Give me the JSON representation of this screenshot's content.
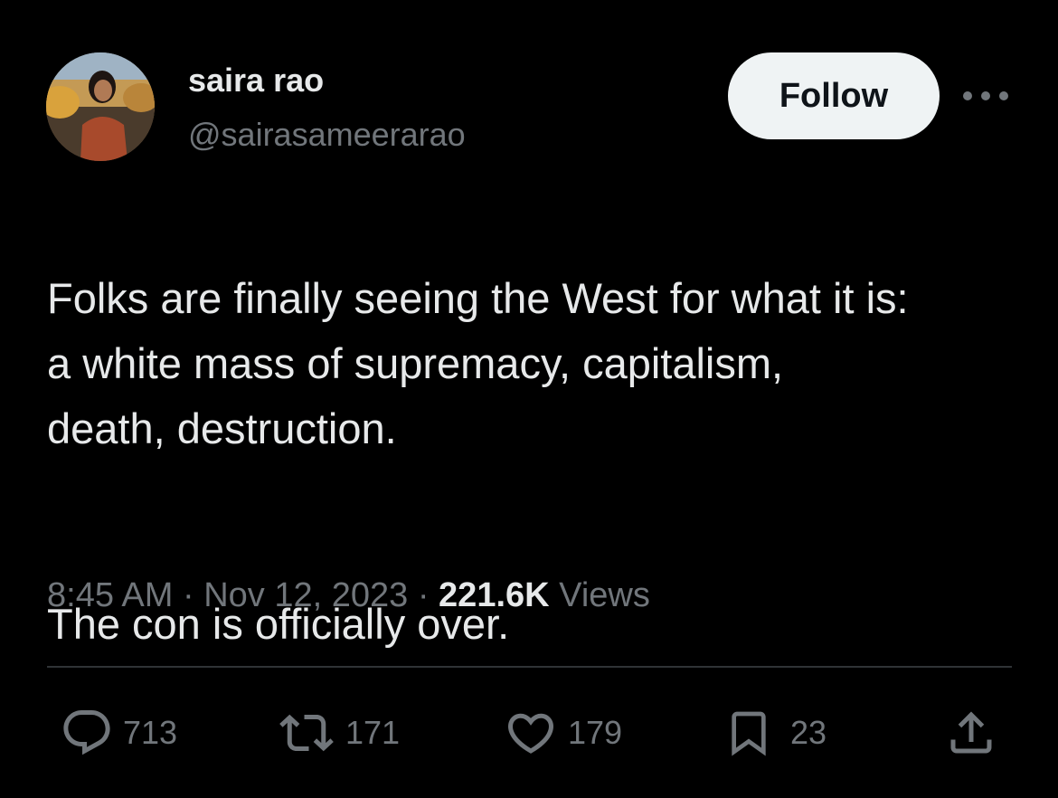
{
  "author": {
    "display_name": "saira rao",
    "handle": "@sairasameerarao",
    "avatar_icon": "profile-photo"
  },
  "header": {
    "follow_label": "Follow",
    "more_icon": "more-horizontal-icon"
  },
  "tweet": {
    "paragraphs": [
      "Folks are finally seeing the West for what it is:\na white mass of supremacy, capitalism,\ndeath, destruction.",
      "The con is officially over."
    ],
    "time": "8:45 AM",
    "separator": "·",
    "date": "Nov 12, 2023",
    "views_count": "221.6K",
    "views_label": "Views"
  },
  "actions": {
    "replies": "713",
    "reposts": "171",
    "likes": "179",
    "bookmarks": "23"
  },
  "colors": {
    "background": "#000000",
    "primary_text": "#e7e9ea",
    "secondary_text": "#71767b",
    "follow_button_bg": "#eff3f4",
    "divider": "#2f3336"
  }
}
